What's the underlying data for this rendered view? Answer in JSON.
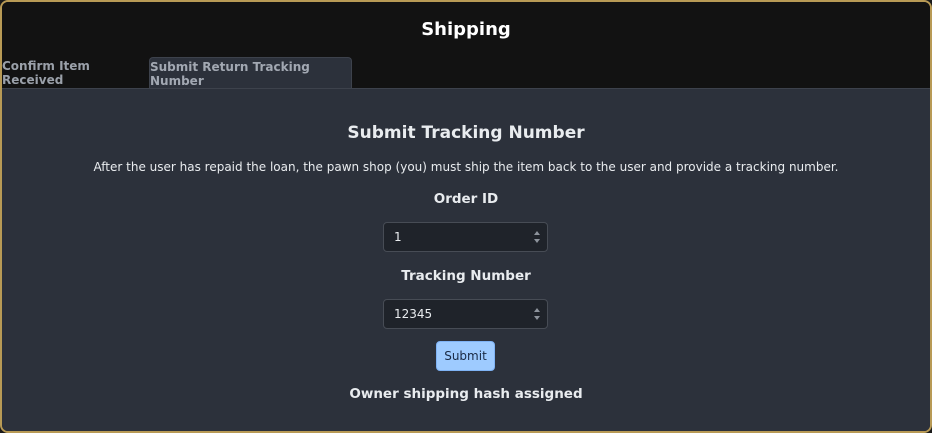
{
  "header": {
    "title": "Shipping"
  },
  "tabs": [
    {
      "label": "Confirm Item Received",
      "active": false
    },
    {
      "label": "Submit Return Tracking Number",
      "active": true
    }
  ],
  "panel": {
    "heading": "Submit Tracking Number",
    "description": "After the user has repaid the loan, the pawn shop (you) must ship the item back to the user and provide a tracking number.",
    "order_id": {
      "label": "Order ID",
      "value": "1"
    },
    "tracking_number": {
      "label": "Tracking Number",
      "value": "12345"
    },
    "submit_label": "Submit",
    "status_text": "Owner shipping hash assigned"
  },
  "colors": {
    "frame_border": "#b89a55",
    "header_bg": "#121212",
    "panel_bg": "#2c313b",
    "input_bg": "#1f232a",
    "button_bg": "#9ecbff"
  }
}
